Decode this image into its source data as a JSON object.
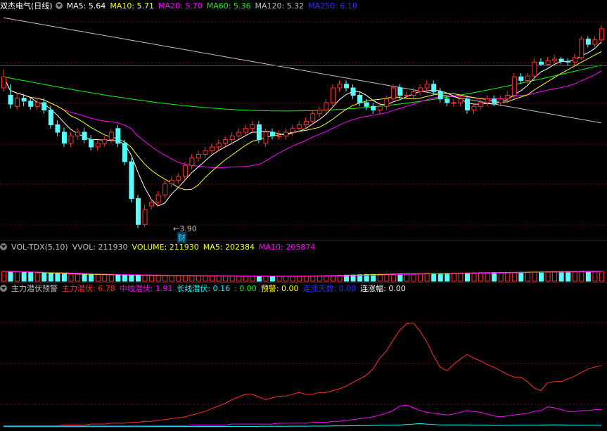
{
  "main_panel": {
    "title": "双杰电气(日线)",
    "indicators": [
      {
        "label": "MA5: 5.64",
        "color": "#ffffff"
      },
      {
        "label": "MA10: 5.71",
        "color": "#ffff00"
      },
      {
        "label": "MA20: 5.70",
        "color": "#ff00ff"
      },
      {
        "label": "MA60: 5.36",
        "color": "#00ff00"
      },
      {
        "label": "MA120: 5.32",
        "color": "#c0c0c0"
      },
      {
        "label": "MA250: 6.10",
        "color": "#3030ff"
      }
    ],
    "low_price": "3.90",
    "fin_marker": "财"
  },
  "volume_panel": {
    "title": "VOL-TDX(5,10)",
    "indicators": [
      {
        "label": "VVOL: 211930",
        "color": "#c0c0c0"
      },
      {
        "label": "VOLUME: 211930",
        "color": "#ffff00"
      },
      {
        "label": "MA5: 202384",
        "color": "#ffff00"
      },
      {
        "label": "MA10: 205874",
        "color": "#ff00ff"
      }
    ]
  },
  "signal_panel": {
    "title": "主力潜伏预警",
    "indicators": [
      {
        "label": "主力潜伏: 6.78",
        "color": "#ff3030"
      },
      {
        "label": "中线潜伏: 1.91",
        "color": "#ff00ff"
      },
      {
        "label": "长线潜伏: 0.16",
        "color": "#00ffff"
      },
      {
        "label": ": 0.00",
        "color": "#00ff00"
      },
      {
        "label": "预警: 0.00",
        "color": "#ffff00"
      },
      {
        "label": "连涨天数: 0.00",
        "color": "#3030ff"
      },
      {
        "label": "连涨幅: 0.00",
        "color": "#ffffff"
      }
    ]
  },
  "chart_data": {
    "type": "candlestick",
    "price_series": {
      "open": [
        5.8,
        5.7,
        5.55,
        5.66,
        5.62,
        5.55,
        5.6,
        5.5,
        5.3,
        5.2,
        5.05,
        5.15,
        5.2,
        5.1,
        5.0,
        5.05,
        5.1,
        5.25,
        5.05,
        4.8,
        4.3,
        3.95,
        4.2,
        4.25,
        4.35,
        4.5,
        4.55,
        4.6,
        4.75,
        4.85,
        4.9,
        4.95,
        5.0,
        5.05,
        5.1,
        5.15,
        5.2,
        5.25,
        5.3,
        5.05,
        5.2,
        5.15,
        5.15,
        5.2,
        5.25,
        5.3,
        5.35,
        5.45,
        5.5,
        5.6,
        5.8,
        5.85,
        5.8,
        5.7,
        5.6,
        5.55,
        5.5,
        5.55,
        5.65,
        5.8,
        5.7,
        5.7,
        5.75,
        5.8,
        5.85,
        5.75,
        5.65,
        5.6,
        5.6,
        5.65,
        5.5,
        5.55,
        5.6,
        5.65,
        5.6,
        5.65,
        5.7,
        5.95,
        5.9,
        5.96,
        6.15,
        6.12,
        6.17,
        6.19,
        6.16,
        6.15,
        6.21,
        6.46,
        6.39,
        6.45
      ],
      "close": [
        5.95,
        5.58,
        5.66,
        5.62,
        5.55,
        5.6,
        5.5,
        5.3,
        5.2,
        5.05,
        5.15,
        5.2,
        5.1,
        5.0,
        5.05,
        5.1,
        5.2,
        5.05,
        4.8,
        4.3,
        3.95,
        4.15,
        4.25,
        4.35,
        4.5,
        4.55,
        4.6,
        4.75,
        4.85,
        4.9,
        4.95,
        5.0,
        5.05,
        5.1,
        5.15,
        5.2,
        5.25,
        5.3,
        5.1,
        5.2,
        5.15,
        5.15,
        5.2,
        5.25,
        5.3,
        5.35,
        5.45,
        5.5,
        5.6,
        5.8,
        5.85,
        5.8,
        5.7,
        5.6,
        5.55,
        5.5,
        5.55,
        5.65,
        5.8,
        5.7,
        5.7,
        5.75,
        5.8,
        5.85,
        5.75,
        5.65,
        5.6,
        5.6,
        5.65,
        5.5,
        5.55,
        5.6,
        5.65,
        5.6,
        5.65,
        5.7,
        5.95,
        5.9,
        5.96,
        6.15,
        6.12,
        6.17,
        6.19,
        6.16,
        6.15,
        6.21,
        6.46,
        6.39,
        6.45,
        6.6
      ],
      "high": [
        6.05,
        5.85,
        5.72,
        5.72,
        5.68,
        5.66,
        5.66,
        5.56,
        5.36,
        5.26,
        5.2,
        5.26,
        5.26,
        5.16,
        5.1,
        5.15,
        5.25,
        5.3,
        5.1,
        4.85,
        4.35,
        4.22,
        4.3,
        4.4,
        4.55,
        4.6,
        4.65,
        4.8,
        4.9,
        4.95,
        5.0,
        5.05,
        5.1,
        5.15,
        5.2,
        5.25,
        5.3,
        5.35,
        5.35,
        5.25,
        5.25,
        5.22,
        5.25,
        5.3,
        5.35,
        5.4,
        5.5,
        5.55,
        5.65,
        5.85,
        5.9,
        5.9,
        5.85,
        5.75,
        5.65,
        5.6,
        5.6,
        5.7,
        5.85,
        5.85,
        5.75,
        5.8,
        5.85,
        5.9,
        5.9,
        5.8,
        5.7,
        5.65,
        5.7,
        5.7,
        5.6,
        5.65,
        5.7,
        5.7,
        5.7,
        5.75,
        6.0,
        6.0,
        6.0,
        6.2,
        6.2,
        6.22,
        6.25,
        6.22,
        6.2,
        6.26,
        6.5,
        6.5,
        6.5,
        6.65
      ],
      "low": [
        5.75,
        5.52,
        5.5,
        5.55,
        5.5,
        5.5,
        5.45,
        5.25,
        5.15,
        5.0,
        5.0,
        5.1,
        5.05,
        4.95,
        4.95,
        5.0,
        5.05,
        5.0,
        4.75,
        4.25,
        3.9,
        3.92,
        4.15,
        4.2,
        4.3,
        4.45,
        4.5,
        4.55,
        4.7,
        4.8,
        4.85,
        4.9,
        4.95,
        5.0,
        5.05,
        5.1,
        5.15,
        5.2,
        5.05,
        5.0,
        5.1,
        5.1,
        5.1,
        5.15,
        5.2,
        5.25,
        5.3,
        5.4,
        5.45,
        5.55,
        5.75,
        5.75,
        5.65,
        5.55,
        5.5,
        5.45,
        5.45,
        5.5,
        5.6,
        5.65,
        5.65,
        5.65,
        5.7,
        5.75,
        5.7,
        5.6,
        5.55,
        5.55,
        5.55,
        5.45,
        5.45,
        5.5,
        5.55,
        5.55,
        5.55,
        5.6,
        5.65,
        5.85,
        5.85,
        5.9,
        6.1,
        6.1,
        6.12,
        6.12,
        6.1,
        6.1,
        6.18,
        6.35,
        6.35,
        6.4
      ]
    },
    "ma_levels": {
      "MA5": 5.64,
      "MA10": 5.71,
      "MA20": 5.7,
      "MA60": 5.36,
      "MA120": 5.32,
      "MA250": 6.1
    },
    "low_marker": 3.9,
    "volume_values": [
      212000,
      198000,
      205000,
      190000,
      185000,
      178000,
      172000,
      165000,
      160000,
      155000,
      150000,
      148000,
      145000,
      142000,
      140000,
      138000,
      136000,
      134000,
      132000,
      130000,
      128000,
      126000,
      124000,
      122000,
      121000,
      120000,
      119000,
      118000,
      117000,
      116000,
      115000,
      114000,
      113000,
      112000,
      111000,
      110000,
      109000,
      108000,
      107000,
      106000,
      105000,
      106000,
      107000,
      108000,
      110000,
      112000,
      114000,
      116000,
      118000,
      122000,
      126000,
      130000,
      134000,
      138000,
      142000,
      146000,
      150000,
      152000,
      154000,
      156000,
      158000,
      160000,
      162000,
      164000,
      166000,
      168000,
      170000,
      172000,
      174000,
      176000,
      178000,
      180000,
      182000,
      184000,
      186000,
      188000,
      190000,
      192000,
      194000,
      196000,
      198000,
      200000,
      202000,
      204000,
      206000,
      208000,
      210000,
      211000,
      211500,
      211930
    ],
    "signal_values": {
      "主力潜伏": [
        0.1,
        0.1,
        0.1,
        0.1,
        0.1,
        0.1,
        0.1,
        0.1,
        0.1,
        0.2,
        0.2,
        0.2,
        0.2,
        0.3,
        0.3,
        0.3,
        0.4,
        0.4,
        0.4,
        0.5,
        0.5,
        0.6,
        0.6,
        0.7,
        0.8,
        0.9,
        1.0,
        1.1,
        1.3,
        1.5,
        1.7,
        2.0,
        2.3,
        2.6,
        3.0,
        3.3,
        3.6,
        3.6,
        3.3,
        3.0,
        3.2,
        3.4,
        3.4,
        3.6,
        3.8,
        3.6,
        3.6,
        3.8,
        3.8,
        4.0,
        4.2,
        4.5,
        4.9,
        5.3,
        5.7,
        6.4,
        7.6,
        8.4,
        9.6,
        10.7,
        11.4,
        11.5,
        10.6,
        9.4,
        7.9,
        6.6,
        6.2,
        6.9,
        7.5,
        8.0,
        7.6,
        7.3,
        6.9,
        6.6,
        6.2,
        5.8,
        5.5,
        5.5,
        5.0,
        4.3,
        4.0,
        4.9,
        5.0,
        5.0,
        5.3,
        5.6,
        6.0,
        6.4,
        6.6,
        6.78
      ],
      "中线潜伏": [
        0.1,
        0.1,
        0.1,
        0.1,
        0.1,
        0.1,
        0.1,
        0.1,
        0.1,
        0.1,
        0.1,
        0.1,
        0.1,
        0.1,
        0.1,
        0.1,
        0.1,
        0.1,
        0.1,
        0.1,
        0.1,
        0.1,
        0.1,
        0.1,
        0.1,
        0.1,
        0.1,
        0.1,
        0.2,
        0.2,
        0.2,
        0.2,
        0.2,
        0.2,
        0.3,
        0.3,
        0.3,
        0.3,
        0.3,
        0.3,
        0.3,
        0.4,
        0.4,
        0.4,
        0.4,
        0.4,
        0.5,
        0.5,
        0.5,
        0.6,
        0.6,
        0.7,
        0.8,
        0.9,
        1.0,
        1.1,
        1.3,
        1.5,
        1.8,
        2.3,
        2.4,
        2.1,
        1.8,
        1.6,
        1.5,
        1.4,
        1.3,
        1.4,
        1.6,
        1.8,
        1.7,
        1.6,
        1.4,
        1.2,
        1.1,
        1.2,
        1.3,
        1.4,
        1.5,
        1.7,
        1.8,
        2.2,
        2.1,
        1.9,
        1.7,
        1.7,
        1.8,
        1.8,
        1.9,
        1.91
      ],
      "长线潜伏": [
        0.02,
        0.02,
        0.02,
        0.02,
        0.02,
        0.02,
        0.02,
        0.02,
        0.02,
        0.02,
        0.02,
        0.02,
        0.02,
        0.02,
        0.02,
        0.02,
        0.02,
        0.02,
        0.02,
        0.02,
        0.02,
        0.02,
        0.03,
        0.03,
        0.03,
        0.03,
        0.03,
        0.03,
        0.03,
        0.03,
        0.04,
        0.04,
        0.04,
        0.04,
        0.05,
        0.05,
        0.05,
        0.05,
        0.05,
        0.06,
        0.06,
        0.06,
        0.06,
        0.07,
        0.07,
        0.07,
        0.08,
        0.08,
        0.08,
        0.09,
        0.1,
        0.11,
        0.12,
        0.13,
        0.14,
        0.15,
        0.16,
        0.17,
        0.18,
        0.2,
        0.25,
        0.3,
        0.35,
        0.3,
        0.25,
        0.22,
        0.2,
        0.2,
        0.2,
        0.2,
        0.18,
        0.17,
        0.16,
        0.15,
        0.15,
        0.16,
        0.16,
        0.17,
        0.17,
        0.17,
        0.18,
        0.2,
        0.22,
        0.2,
        0.18,
        0.17,
        0.16,
        0.16,
        0.16,
        0.16
      ]
    }
  }
}
